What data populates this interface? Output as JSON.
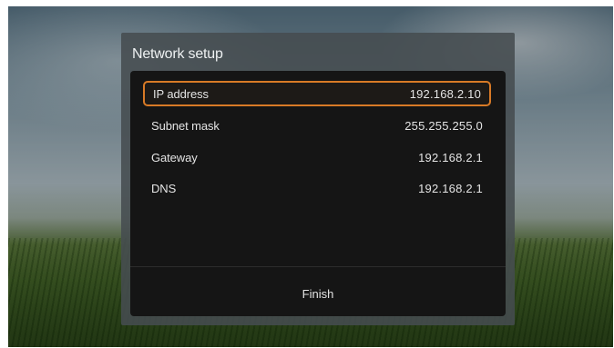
{
  "dialog": {
    "title": "Network setup",
    "fields": [
      {
        "label": "IP address",
        "value": "192.168.2.10",
        "selected": true
      },
      {
        "label": "Subnet mask",
        "value": "255.255.255.0",
        "selected": false
      },
      {
        "label": "Gateway",
        "value": "192.168.2.1",
        "selected": false
      },
      {
        "label": "DNS",
        "value": "192.168.2.1",
        "selected": false
      }
    ],
    "finish_label": "Finish"
  },
  "colors": {
    "focus_border": "#d87a26",
    "panel_bg": "#151515",
    "dialog_bg": "#464c50"
  }
}
